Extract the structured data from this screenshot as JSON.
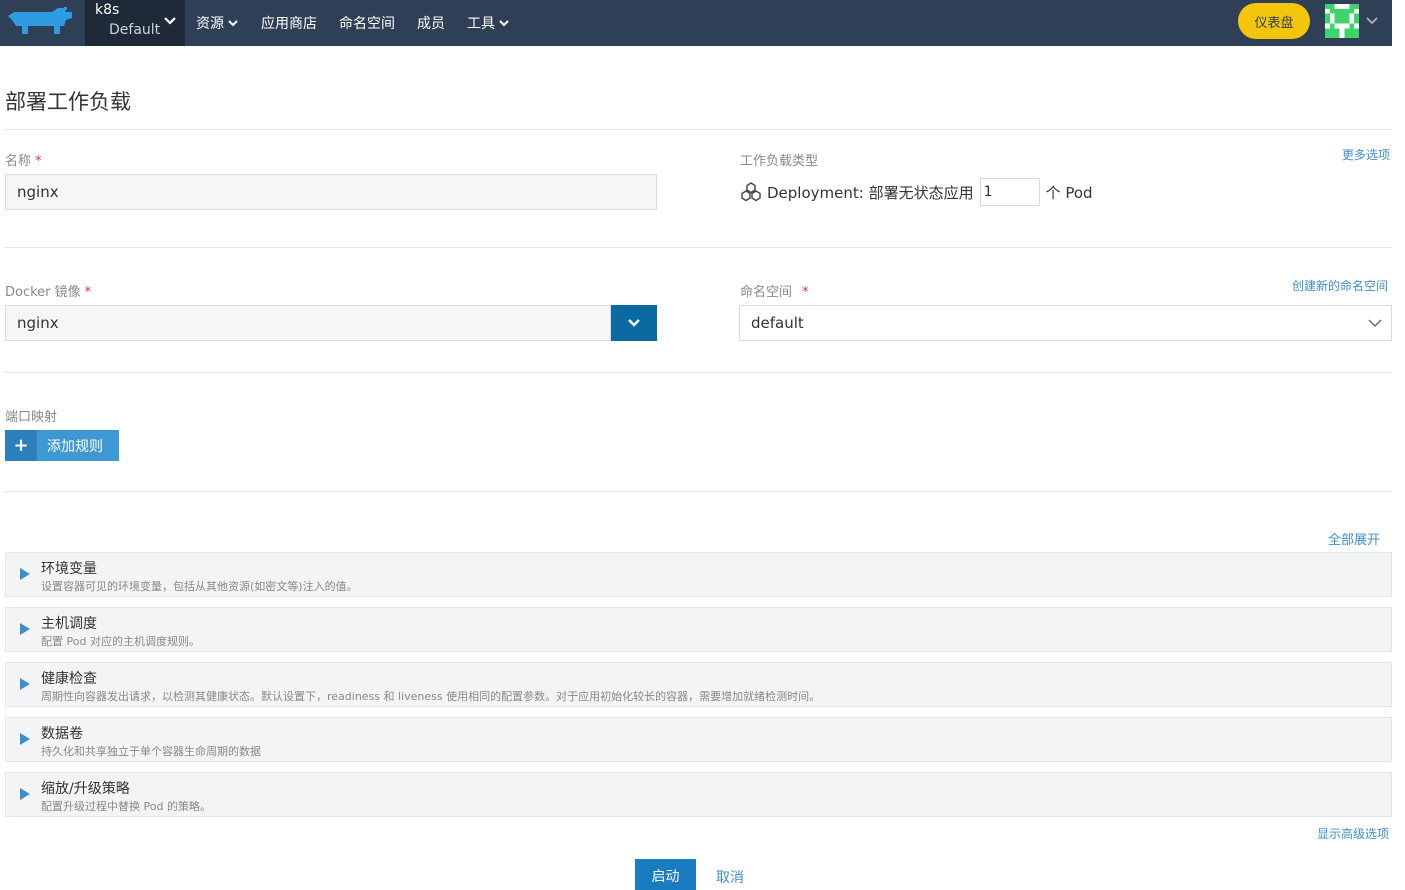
{
  "header": {
    "logo_icon": "rancher-cow-icon",
    "cluster_name": "k8s",
    "project_name": "Default",
    "nav": [
      {
        "label": "资源",
        "has_dropdown": true
      },
      {
        "label": "应用商店",
        "has_dropdown": false
      },
      {
        "label": "命名空间",
        "has_dropdown": false
      },
      {
        "label": "成员",
        "has_dropdown": false
      },
      {
        "label": "工具",
        "has_dropdown": true
      }
    ],
    "dashboard_label": "仪表盘",
    "accent_color": "#f3c60c",
    "bar_color": "#2f3f55"
  },
  "page": {
    "title": "部署工作负载"
  },
  "form": {
    "name": {
      "label": "名称",
      "required_mark": "*",
      "value": "nginx"
    },
    "workload_type": {
      "label": "工作负载类型",
      "more_options": "更多选项",
      "type_text": "Deployment: 部署无状态应用",
      "scale": "1",
      "unit": "个 Pod"
    },
    "image": {
      "label": "Docker 镜像",
      "required_mark": "*",
      "value": "nginx"
    },
    "namespace": {
      "label": "命名空间",
      "required_mark": "*",
      "create_link": "创建新的命名空间",
      "value": "default"
    },
    "ports": {
      "label": "端口映射",
      "add_rule": "添加规则"
    }
  },
  "sections": {
    "expand_all": "全部展开",
    "items": [
      {
        "title": "环境变量",
        "desc": "设置容器可见的环境变量，包括从其他资源(如密文等)注入的值。"
      },
      {
        "title": "主机调度",
        "desc": "配置 Pod 对应的主机调度规则。"
      },
      {
        "title": "健康检查",
        "desc": "周期性向容器发出请求，以检测其健康状态。默认设置下，readiness 和 liveness 使用相同的配置参数。对于应用初始化较长的容器，需要增加就绪检测时间。"
      },
      {
        "title": "数据卷",
        "desc": "持久化和共享独立于单个容器生命周期的数据"
      },
      {
        "title": "缩放/升级策略",
        "desc": "配置升级过程中替换 Pod 的策略。"
      }
    ],
    "show_advanced": "显示高级选项"
  },
  "actions": {
    "launch": "启动",
    "cancel": "取消"
  }
}
